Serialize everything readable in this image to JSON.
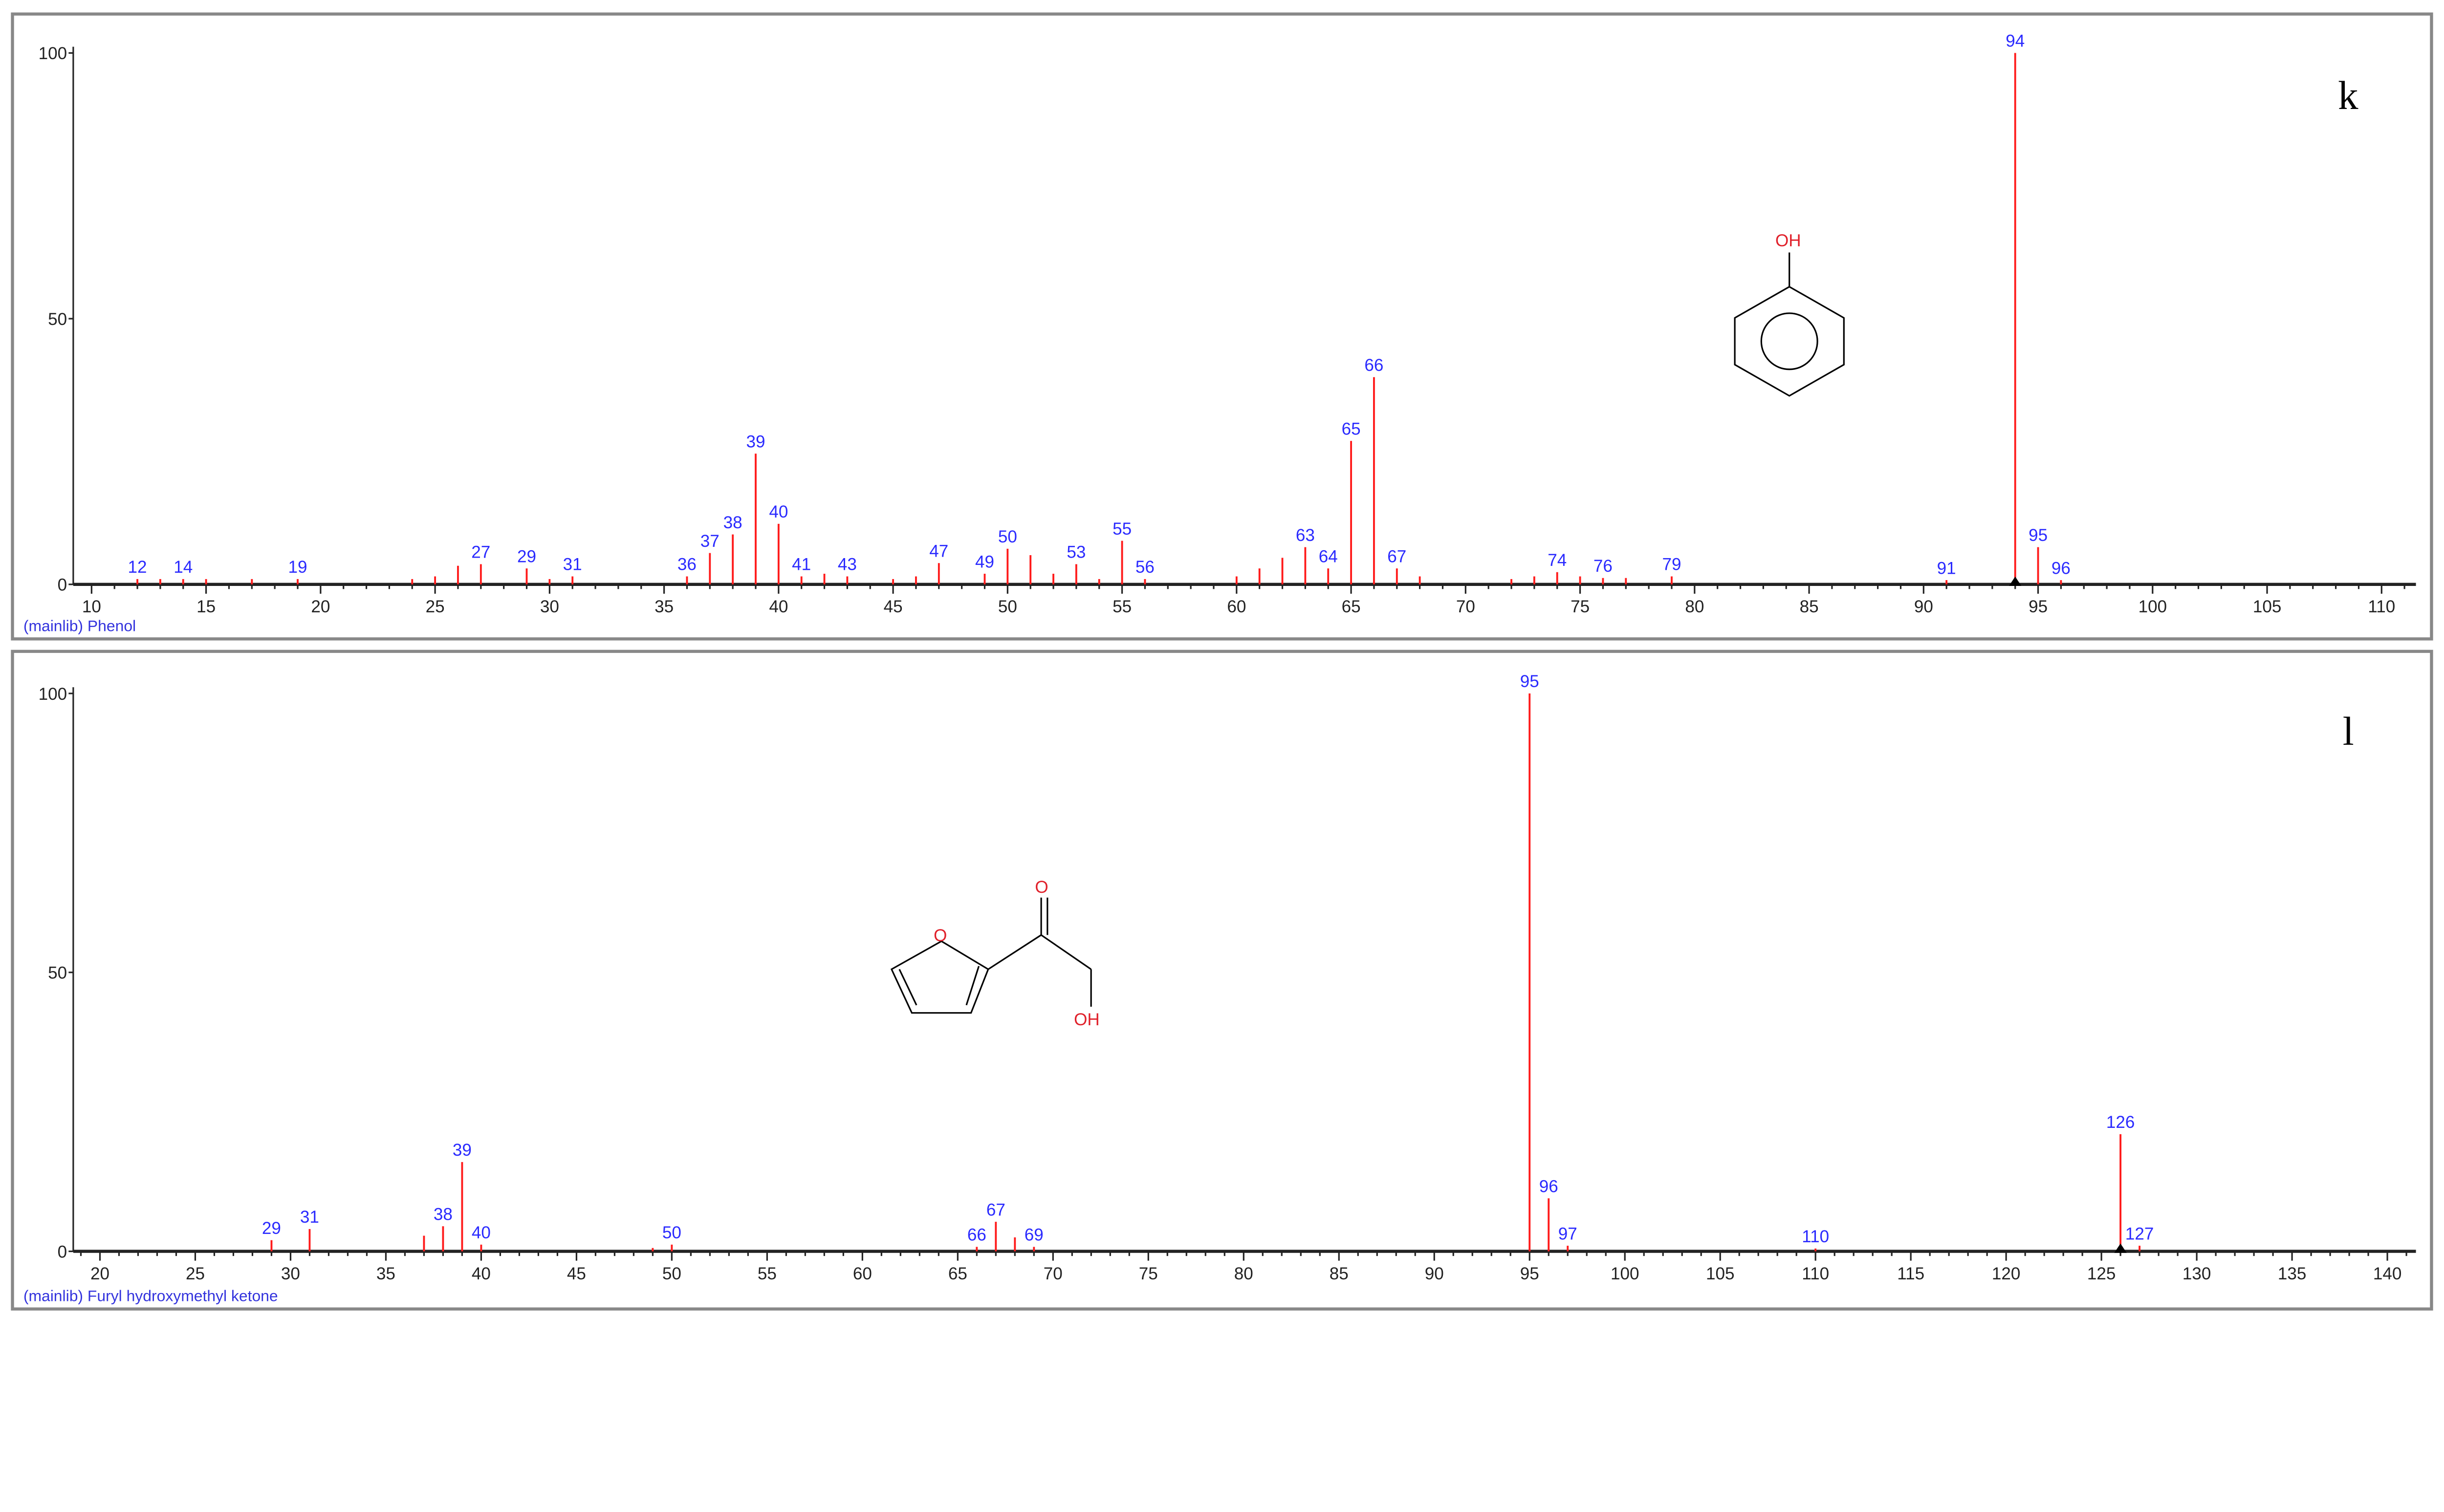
{
  "chart_data": [
    {
      "type": "bar",
      "title": "Phenol",
      "panel_letter": "k",
      "library_label": "(mainlib) Phenol",
      "xlim": [
        9.2,
        111.5
      ],
      "ylim": [
        0,
        100
      ],
      "xticks": [
        10,
        15,
        20,
        25,
        30,
        35,
        40,
        45,
        50,
        55,
        60,
        65,
        70,
        75,
        80,
        85,
        90,
        95,
        100,
        105,
        110
      ],
      "yticks": [
        0,
        50,
        100
      ],
      "molecular_ion_marker": 94,
      "structure_labels": {
        "hydroxyl": "OH"
      },
      "peaks": [
        {
          "mz": 12,
          "intensity": 1,
          "label": "12"
        },
        {
          "mz": 13,
          "intensity": 1
        },
        {
          "mz": 14,
          "intensity": 1,
          "label": "14"
        },
        {
          "mz": 15,
          "intensity": 1
        },
        {
          "mz": 17,
          "intensity": 1
        },
        {
          "mz": 19,
          "intensity": 1,
          "label": "19"
        },
        {
          "mz": 24,
          "intensity": 1
        },
        {
          "mz": 25,
          "intensity": 1.5
        },
        {
          "mz": 26,
          "intensity": 3.5
        },
        {
          "mz": 27,
          "intensity": 3.8,
          "label": "27"
        },
        {
          "mz": 29,
          "intensity": 3,
          "label": "29"
        },
        {
          "mz": 30,
          "intensity": 1
        },
        {
          "mz": 31,
          "intensity": 1.5,
          "label": "31"
        },
        {
          "mz": 36,
          "intensity": 1.5,
          "label": "36"
        },
        {
          "mz": 37,
          "intensity": 5.9,
          "label": "37"
        },
        {
          "mz": 38,
          "intensity": 9.4,
          "label": "38"
        },
        {
          "mz": 39,
          "intensity": 24.6,
          "label": "39"
        },
        {
          "mz": 40,
          "intensity": 11.4,
          "label": "40"
        },
        {
          "mz": 41,
          "intensity": 1.5,
          "label": "41"
        },
        {
          "mz": 42,
          "intensity": 2
        },
        {
          "mz": 43,
          "intensity": 1.5,
          "label": "43"
        },
        {
          "mz": 45,
          "intensity": 1
        },
        {
          "mz": 46,
          "intensity": 1.5
        },
        {
          "mz": 47,
          "intensity": 4,
          "label": "47"
        },
        {
          "mz": 49,
          "intensity": 2,
          "label": "49"
        },
        {
          "mz": 50,
          "intensity": 6.7,
          "label": "50"
        },
        {
          "mz": 51,
          "intensity": 5.5
        },
        {
          "mz": 52,
          "intensity": 2
        },
        {
          "mz": 53,
          "intensity": 3.8,
          "label": "53"
        },
        {
          "mz": 54,
          "intensity": 1
        },
        {
          "mz": 55,
          "intensity": 8.2,
          "label": "55"
        },
        {
          "mz": 56,
          "intensity": 1,
          "label": "56"
        },
        {
          "mz": 60,
          "intensity": 1.5
        },
        {
          "mz": 61,
          "intensity": 3
        },
        {
          "mz": 62,
          "intensity": 5
        },
        {
          "mz": 63,
          "intensity": 7,
          "label": "63"
        },
        {
          "mz": 64,
          "intensity": 3,
          "label": "64"
        },
        {
          "mz": 65,
          "intensity": 27,
          "label": "65"
        },
        {
          "mz": 66,
          "intensity": 39,
          "label": "66"
        },
        {
          "mz": 67,
          "intensity": 3,
          "label": "67"
        },
        {
          "mz": 68,
          "intensity": 1.5
        },
        {
          "mz": 72,
          "intensity": 1
        },
        {
          "mz": 73,
          "intensity": 1.5
        },
        {
          "mz": 74,
          "intensity": 2.3,
          "label": "74"
        },
        {
          "mz": 75,
          "intensity": 1.5
        },
        {
          "mz": 76,
          "intensity": 1.2,
          "label": "76"
        },
        {
          "mz": 77,
          "intensity": 1.2
        },
        {
          "mz": 79,
          "intensity": 1.5,
          "label": "79"
        },
        {
          "mz": 91,
          "intensity": 0.8,
          "label": "91"
        },
        {
          "mz": 94,
          "intensity": 100,
          "label": "94"
        },
        {
          "mz": 95,
          "intensity": 7,
          "label": "95"
        },
        {
          "mz": 96,
          "intensity": 0.8,
          "label": "96"
        }
      ]
    },
    {
      "type": "bar",
      "title": "Furyl hydroxymethyl ketone",
      "panel_letter": "l",
      "library_label": "(mainlib) Furyl hydroxymethyl ketone",
      "xlim": [
        18.6,
        141.5
      ],
      "ylim": [
        0,
        100
      ],
      "xticks": [
        20,
        25,
        30,
        35,
        40,
        45,
        50,
        55,
        60,
        65,
        70,
        75,
        80,
        85,
        90,
        95,
        100,
        105,
        110,
        115,
        120,
        125,
        130,
        135,
        140
      ],
      "yticks": [
        0,
        50,
        100
      ],
      "molecular_ion_marker": 126,
      "structure_labels": {
        "ring_oxygen": "O",
        "carbonyl": "O",
        "hydroxyl": "OH"
      },
      "peaks": [
        {
          "mz": 29,
          "intensity": 2,
          "label": "29"
        },
        {
          "mz": 31,
          "intensity": 4,
          "label": "31"
        },
        {
          "mz": 37,
          "intensity": 2.8
        },
        {
          "mz": 38,
          "intensity": 4.5,
          "label": "38"
        },
        {
          "mz": 39,
          "intensity": 16,
          "label": "39"
        },
        {
          "mz": 40,
          "intensity": 1.2,
          "label": "40"
        },
        {
          "mz": 49,
          "intensity": 0.6
        },
        {
          "mz": 50,
          "intensity": 1.2,
          "label": "50"
        },
        {
          "mz": 66,
          "intensity": 0.8,
          "label": "66"
        },
        {
          "mz": 67,
          "intensity": 5.3,
          "label": "67"
        },
        {
          "mz": 68,
          "intensity": 2.5
        },
        {
          "mz": 69,
          "intensity": 0.8,
          "label": "69"
        },
        {
          "mz": 95,
          "intensity": 100,
          "label": "95"
        },
        {
          "mz": 96,
          "intensity": 9.5,
          "label": "96"
        },
        {
          "mz": 97,
          "intensity": 1,
          "label": "97"
        },
        {
          "mz": 110,
          "intensity": 0.5,
          "label": "110"
        },
        {
          "mz": 126,
          "intensity": 21,
          "label": "126"
        },
        {
          "mz": 127,
          "intensity": 1,
          "label": "127"
        }
      ]
    }
  ],
  "colors": {
    "peak": "#ff1a1a",
    "peak_label": "#2a2aff",
    "axis": "#222222",
    "frame": "#888888"
  }
}
